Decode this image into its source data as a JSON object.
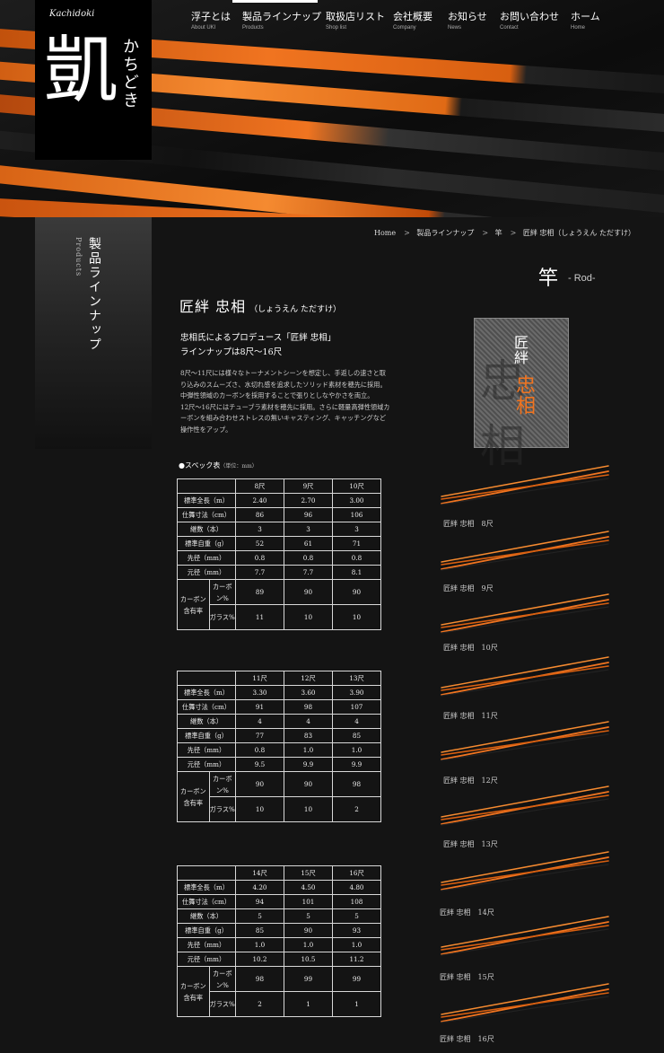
{
  "logo": {
    "small": "Kachidoki",
    "big": "凱",
    "kana": "かちどき"
  },
  "nav": {
    "items": [
      {
        "jp": "浮子とは",
        "en": "About UKI"
      },
      {
        "jp": "製品ラインナップ",
        "en": "Products"
      },
      {
        "jp": "取扱店リスト",
        "en": "Shop list"
      },
      {
        "jp": "会社概要",
        "en": "Company"
      },
      {
        "jp": "お知らせ",
        "en": "News"
      },
      {
        "jp": "お問い合わせ",
        "en": "Contact"
      },
      {
        "jp": "ホーム",
        "en": "Home"
      }
    ]
  },
  "sidebar": {
    "jp": "製品ラインナップ",
    "en": "Products"
  },
  "breadcrumb": [
    "Home",
    "製品ラインナップ",
    "竿",
    "匠絆 忠相（しょうえん ただすけ）"
  ],
  "category": {
    "jp": "竿",
    "en": "- Rod-"
  },
  "product": {
    "title": "匠絆 忠相",
    "reading": "（しょうえん ただすけ）",
    "lead1": "忠相氏によるプロデュース「匠絆 忠相」",
    "lead2": "ラインナップは8尺〜16尺",
    "desc1": "8尺〜11尺には様々なトーナメントシーンを想定し、手返しの速さと取り込みのスムーズさ、水切れ感を追求したソリッド素材を穂先に採用。中弾性領域のカーボンを採用することで張りとしなやかさを両立。",
    "desc2": "12尺〜16尺にはチューブラ素材を穂先に採用。さらに軽量高弾性領域カーボンを組み合わせストレスの無いキャスティング、キャッチングなど操作性をアップ。"
  },
  "badge": {
    "line1": "匠絆",
    "line2": "忠相",
    "bg": "忠相"
  },
  "spec": {
    "heading": "●スペック表",
    "unit": "（単位：mm）",
    "row_labels": {
      "length": "標準全長（m）",
      "closed": "仕舞寸法（cm）",
      "pieces": "継数（本）",
      "weight": "標準自重（g）",
      "tip": "先径（mm）",
      "butt": "元径（mm）",
      "content": "カーボン含有率",
      "carbon": "カーボン%",
      "glass": "ガラス%"
    },
    "tables": [
      {
        "cols": [
          "8尺",
          "9尺",
          "10尺"
        ],
        "length": [
          "2.40",
          "2.70",
          "3.00"
        ],
        "closed": [
          "86",
          "96",
          "106"
        ],
        "pieces": [
          "3",
          "3",
          "3"
        ],
        "weight": [
          "52",
          "61",
          "71"
        ],
        "tip": [
          "0.8",
          "0.8",
          "0.8"
        ],
        "butt": [
          "7.7",
          "7.7",
          "8.1"
        ],
        "carbon": [
          "89",
          "90",
          "90"
        ],
        "glass": [
          "11",
          "10",
          "10"
        ]
      },
      {
        "cols": [
          "11尺",
          "12尺",
          "13尺"
        ],
        "length": [
          "3.30",
          "3.60",
          "3.90"
        ],
        "closed": [
          "91",
          "98",
          "107"
        ],
        "pieces": [
          "4",
          "4",
          "4"
        ],
        "weight": [
          "77",
          "83",
          "85"
        ],
        "tip": [
          "0.8",
          "1.0",
          "1.0"
        ],
        "butt": [
          "9.5",
          "9.9",
          "9.9"
        ],
        "carbon": [
          "90",
          "90",
          "98"
        ],
        "glass": [
          "10",
          "10",
          "2"
        ]
      },
      {
        "cols": [
          "14尺",
          "15尺",
          "16尺"
        ],
        "length": [
          "4.20",
          "4.50",
          "4.80"
        ],
        "closed": [
          "94",
          "101",
          "108"
        ],
        "pieces": [
          "5",
          "5",
          "5"
        ],
        "weight": [
          "85",
          "90",
          "93"
        ],
        "tip": [
          "1.0",
          "1.0",
          "1.0"
        ],
        "butt": [
          "10.2",
          "10.5",
          "11.2"
        ],
        "carbon": [
          "98",
          "99",
          "99"
        ],
        "glass": [
          "2",
          "1",
          "1"
        ]
      }
    ]
  },
  "rods": [
    {
      "label": "匠絆 忠相　8尺"
    },
    {
      "label": "匠絆 忠相　9尺"
    },
    {
      "label": "匠絆 忠相　10尺"
    },
    {
      "label": "匠絆 忠相　11尺"
    },
    {
      "label": "匠絆 忠相　12尺"
    },
    {
      "label": "匠絆 忠相　13尺"
    },
    {
      "label": "匠絆 忠相　14尺"
    },
    {
      "label": "匠絆 忠相　15尺"
    },
    {
      "label": "匠絆 忠相　16尺"
    }
  ],
  "colors": {
    "accent": "#f07420",
    "bg": "#141414"
  }
}
